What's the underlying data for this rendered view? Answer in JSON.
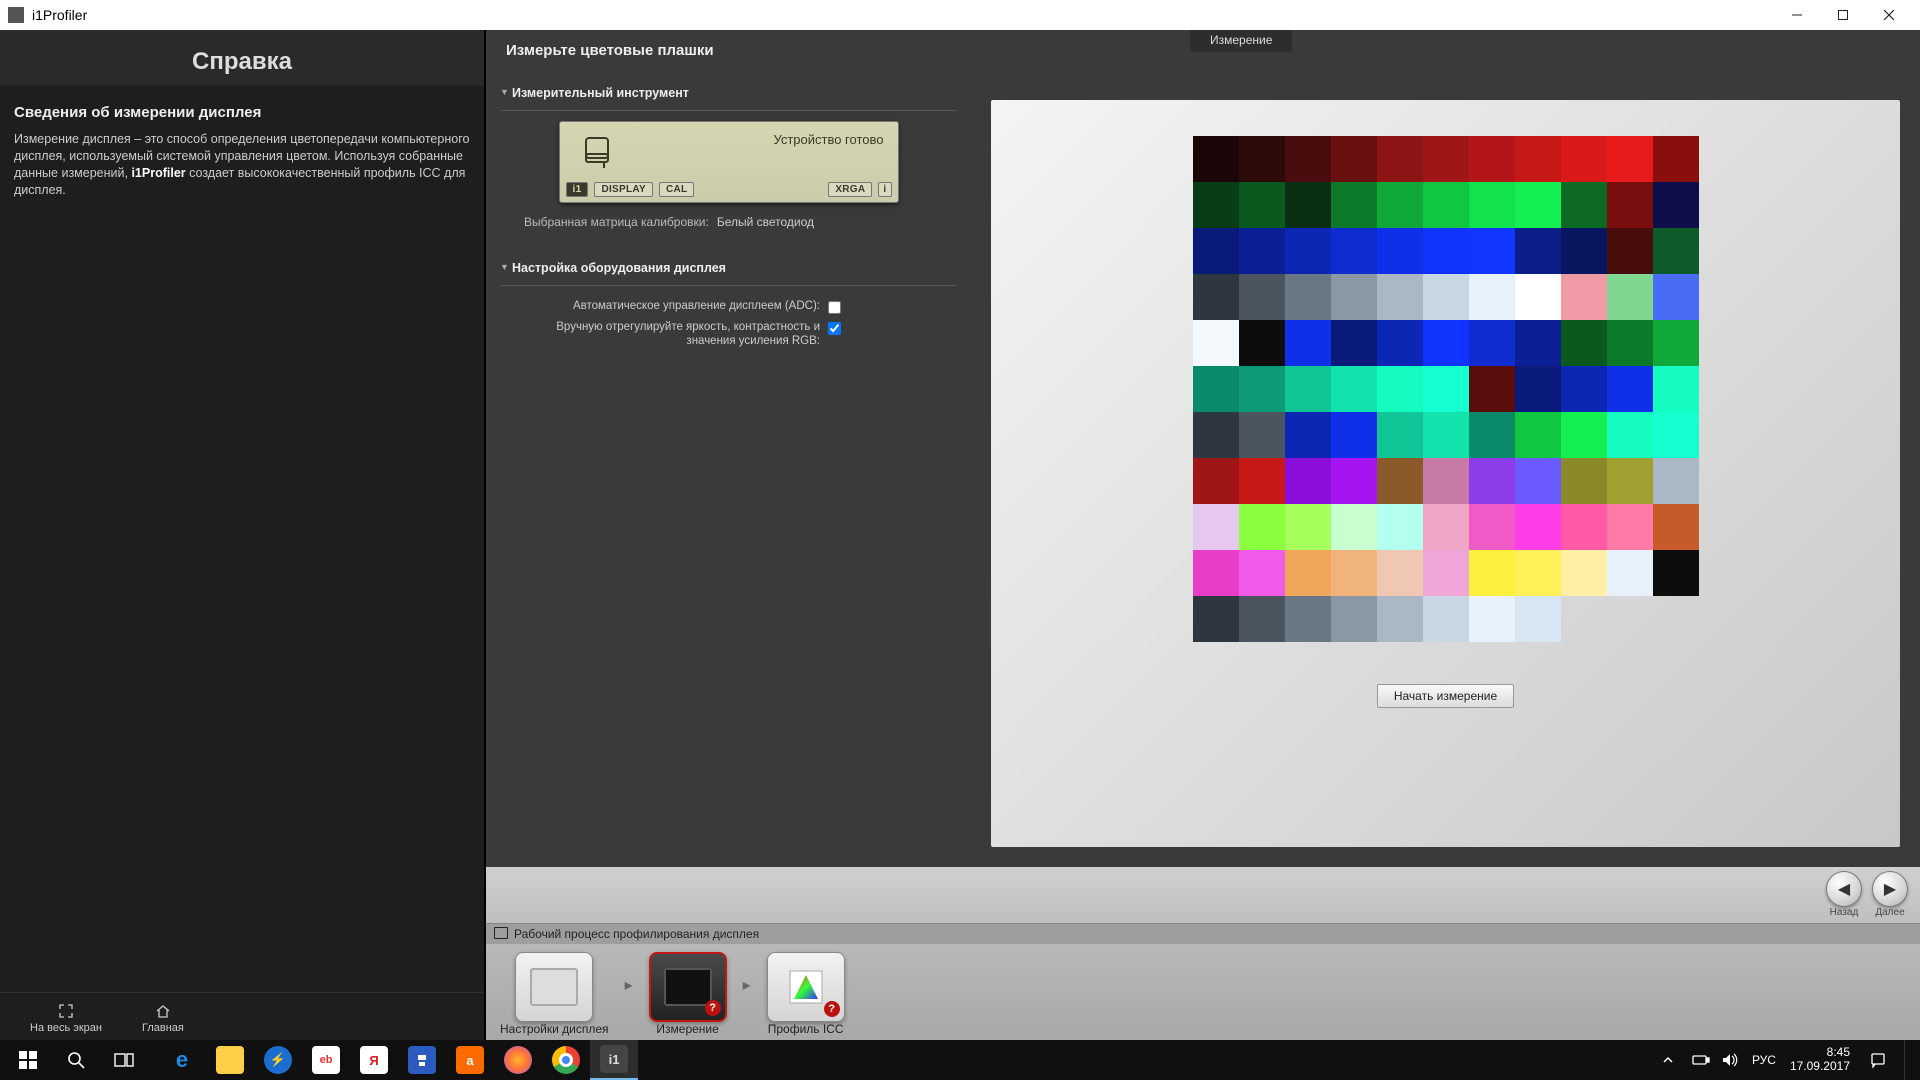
{
  "window": {
    "title": "i1Profiler"
  },
  "help": {
    "title": "Справка",
    "subtitle": "Сведения об измерении дисплея",
    "body_pre": "Измерение дисплея – это способ определения цветопередачи компьютерного дисплея, используемый системой управления цветом. Используя собранные данные измерений, ",
    "body_bold": "i1Profiler",
    "body_post": " создает высококачественный профиль ICC для дисплея."
  },
  "help_footer": {
    "fullscreen": "На весь экран",
    "home": "Главная"
  },
  "main": {
    "title": "Измерьте цветовые плашки",
    "tab_label": "Измерение"
  },
  "sections": {
    "instrument": "Измерительный инструмент",
    "display_hw": "Настройка оборудования дисплея"
  },
  "instrument": {
    "status": "Устройство готово",
    "badge_i1": "i1",
    "badge_display": "DISPLAY",
    "badge_cal": "CAL",
    "badge_xrga": "XRGA"
  },
  "calib": {
    "label": "Выбранная матрица калибровки:",
    "value": "Белый светодиод"
  },
  "options": {
    "adc": "Автоматическое управление дисплеем (ADC):",
    "manual": "Вручную отрегулируйте яркость, контрастность и значения усиления RGB:"
  },
  "preview": {
    "start_btn": "Начать измерение"
  },
  "nav": {
    "back": "Назад",
    "next": "Далее"
  },
  "workflow": {
    "title": "Рабочий процесс профилирования дисплея",
    "step1": "Настройки дисплея",
    "step2": "Измерение",
    "step3": "Профиль ICC"
  },
  "taskbar": {
    "lang": "РУС",
    "time": "8:45",
    "date": "17.09.2017"
  },
  "patches": [
    [
      "#1a0606",
      "#2d0a0a",
      "#4a0d0d",
      "#6b1010",
      "#8b1414",
      "#a01515",
      "#b31616",
      "#c71818",
      "#d81919",
      "#e81a1a",
      "#8a0e0e"
    ],
    [
      "#083d15",
      "#0a5a1f",
      "#0a2f12",
      "#0d7a2a",
      "#10a838",
      "#11c641",
      "#12e24b",
      "#13f050",
      "#0c6a25",
      "#7a0d0d",
      "#0d0d4a"
    ],
    [
      "#0a1a7a",
      "#0b1f95",
      "#0d27b5",
      "#0e2ccf",
      "#0f30e8",
      "#1033fe",
      "#1236ff",
      "#0a1d88",
      "#08155f",
      "#4a0d0d",
      "#0d5a2a"
    ],
    [
      "#2e3740",
      "#4a5560",
      "#6a7784",
      "#8a97a5",
      "#aab7c5",
      "#c9d6e3",
      "#e6f1fb",
      "#ffffff",
      "#f09aa6",
      "#7fd78f",
      "#4a6bf3"
    ],
    [
      "#f2f8fb",
      "#0d0d0d",
      "#0f30e8",
      "#0a1a7a",
      "#0d27b5",
      "#1033fe",
      "#0e2ccf",
      "#0b1f95",
      "#0a5a1f",
      "#0d7a2a",
      "#10a838"
    ],
    [
      "#0a8a6a",
      "#0d9a78",
      "#10c696",
      "#12e2ab",
      "#14fcc0",
      "#16ffd0",
      "#5a0d0d",
      "#0a1a7a",
      "#0d27b5",
      "#0f30e8",
      "#14fcc0"
    ],
    [
      "#2e3740",
      "#4a5560",
      "#0d27b5",
      "#0f30e8",
      "#10c696",
      "#12e2ab",
      "#0a8a6a",
      "#11c641",
      "#13f050",
      "#14fcc0",
      "#16ffd0"
    ],
    [
      "#a01515",
      "#c71818",
      "#8a0dd8",
      "#a614f0",
      "#8a5a2a",
      "#c77aa6",
      "#8a3de8",
      "#6a5aff",
      "#8a8a2a",
      "#a0a030",
      "#aab7c5"
    ],
    [
      "#e6c7f0",
      "#8aff3d",
      "#a6ff5a",
      "#c7ffd0",
      "#b3fff0",
      "#f0a6c7",
      "#f05ac7",
      "#ff3de8",
      "#ff5aa6",
      "#ff7aa6",
      "#c75a2a"
    ],
    [
      "#e83dc7",
      "#f05ae8",
      "#f0a65a",
      "#f0b37a",
      "#f0c7b3",
      "#f0a6d8",
      "#fff03d",
      "#fff05a",
      "#fff0a6",
      "#e6f1fb",
      "#0d0d0d"
    ],
    [
      "#2e3740",
      "#4a5560",
      "#6a7784",
      "#8a97a5",
      "#aab7c5",
      "#c9d6e3",
      "#e6f1fb",
      "#d8e6f3",
      "",
      "",
      ""
    ]
  ]
}
